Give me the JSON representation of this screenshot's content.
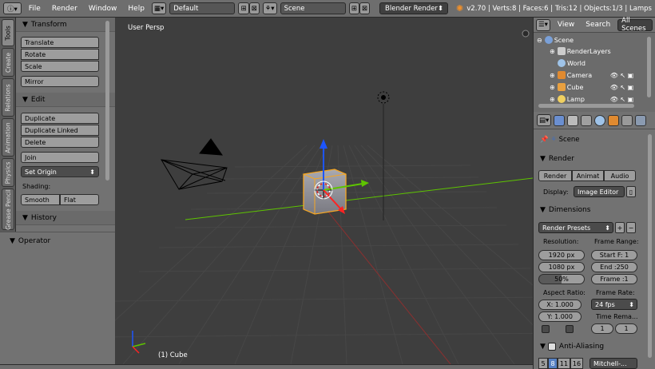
{
  "header": {
    "menus": [
      "File",
      "Render",
      "Window",
      "Help"
    ],
    "layout": "Default",
    "scene": "Scene",
    "engine": "Blender Render",
    "stats": "v2.70 | Verts:8 | Faces:6 | Tris:12 | Objects:1/3 | Lamps"
  },
  "tool_tabs": [
    "Tools",
    "Create",
    "Relations",
    "Animation",
    "Physics",
    "Grease Pencil"
  ],
  "toolshelf": {
    "transform_title": "Transform",
    "transform_buttons": [
      "Translate",
      "Rotate",
      "Scale"
    ],
    "mirror": "Mirror",
    "edit_title": "Edit",
    "edit_buttons": [
      "Duplicate",
      "Duplicate Linked",
      "Delete"
    ],
    "join": "Join",
    "set_origin": "Set Origin",
    "shading_label": "Shading:",
    "smooth": "Smooth",
    "flat": "Flat",
    "history_title": "History"
  },
  "operator": {
    "title": "Operator"
  },
  "viewport": {
    "view_name": "User Persp",
    "active_object": "(1) Cube"
  },
  "outliner": {
    "menu_view": "View",
    "menu_search": "Search",
    "filter": "All Scenes",
    "rows": [
      "Scene",
      "RenderLayers",
      "World",
      "Camera",
      "Cube",
      "Lamp"
    ]
  },
  "properties": {
    "scene_breadcrumb": "Scene",
    "render_title": "Render",
    "render_btn": "Render",
    "anim_btn": "Animat",
    "audio_btn": "Audio",
    "display_label": "Display:",
    "display_value": "Image Editor",
    "dimensions_title": "Dimensions",
    "render_presets": "Render Presets",
    "resolution_label": "Resolution:",
    "res_x": "1920 px",
    "res_y": "1080 px",
    "res_pct": "50%",
    "frame_range_label": "Frame Range:",
    "start": "Start F: 1",
    "end": "End :250",
    "frame": "Frame :1",
    "aspect_label": "Aspect Ratio:",
    "aspect_x": "X: 1.000",
    "aspect_y": "Y: 1.000",
    "frame_rate_label": "Frame Rate:",
    "fps": "24 fps",
    "time_remap": "Time Rema...",
    "remap_old": "1",
    "remap_new": "1",
    "aa_title": "Anti-Aliasing",
    "aa_samples": [
      "5",
      "8",
      "11",
      "16"
    ],
    "aa_filter": "Mitchell-..."
  },
  "colors": {
    "x_axis": "#5ec400",
    "y_axis": "#1d55ff",
    "z_axis": "#ff2222",
    "selection": "#f5a623"
  }
}
